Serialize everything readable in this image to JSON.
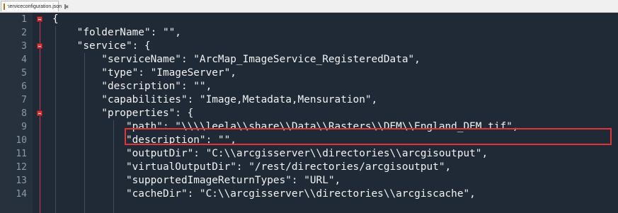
{
  "tab": {
    "filename": "serviceconfiguration.json"
  },
  "colors": {
    "background": "#1f2a36",
    "gutter": "#26313d",
    "text": "#f2f2f2",
    "line_numbers": "#8a9aab",
    "fold_marker": "#d9363e",
    "highlight_border": "#e03535"
  },
  "lines": [
    {
      "n": "1",
      "text": "{"
    },
    {
      "n": "2",
      "text": "    \"folderName\": \"\","
    },
    {
      "n": "3",
      "text": "    \"service\": {"
    },
    {
      "n": "4",
      "text": "        \"serviceName\": \"ArcMap_ImageService_RegisteredData\","
    },
    {
      "n": "5",
      "text": "        \"type\": \"ImageServer\","
    },
    {
      "n": "6",
      "text": "        \"description\": \"\","
    },
    {
      "n": "7",
      "text": "        \"capabilities\": \"Image,Metadata,Mensuration\","
    },
    {
      "n": "8",
      "text": "        \"properties\": {"
    },
    {
      "n": "9",
      "text": "            \"path\": \"\\\\\\\\leela\\\\share\\\\Data\\\\Rasters\\\\DEM\\\\England_DEM.tif\","
    },
    {
      "n": "10",
      "text": "            \"description\": \"\","
    },
    {
      "n": "11",
      "text": "            \"outputDir\": \"C:\\\\arcgisserver\\\\directories\\\\arcgisoutput\","
    },
    {
      "n": "12",
      "text": "            \"virtualOutputDir\": \"/rest/directories/arcgisoutput\","
    },
    {
      "n": "13",
      "text": "            \"supportedImageReturnTypes\": \"URL\","
    },
    {
      "n": "14",
      "text": "            \"cacheDir\": \"C:\\\\arcgisserver\\\\directories\\\\arcgiscache\","
    }
  ]
}
